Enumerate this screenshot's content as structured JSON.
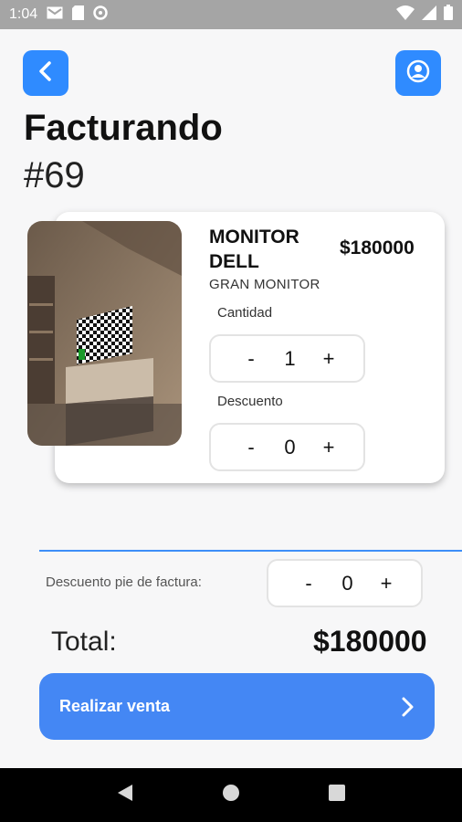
{
  "status_bar": {
    "time": "1:04",
    "icons": [
      "mail-icon",
      "sim-card-icon",
      "at-sign-icon",
      "wifi-icon",
      "signal-icon",
      "battery-icon"
    ]
  },
  "header": {
    "back_icon": "chevron-left-icon",
    "profile_icon": "user-circle-icon",
    "title": "Facturando",
    "invoice_number": "#69"
  },
  "product": {
    "name": "MONITOR DELL",
    "price": "$180000",
    "description": "GRAN MONITOR",
    "quantity_label": "Cantidad",
    "quantity_value": "1",
    "discount_label": "Descuento",
    "discount_value": "0",
    "minus": "-",
    "plus": "+"
  },
  "footer": {
    "discount_label": "Descuento pie de factura:",
    "discount_value": "0",
    "minus": "-",
    "plus": "+",
    "total_label": "Total:",
    "total_value": "$180000",
    "sell_button_label": "Realizar venta",
    "sell_icon": "chevron-right-icon"
  },
  "nav_bar": {
    "icons": [
      "back-triangle-icon",
      "home-circle-icon",
      "recents-square-icon"
    ]
  },
  "colors": {
    "accent": "#2f8bff",
    "button": "#4487f4",
    "divider": "#3d8ef8"
  }
}
